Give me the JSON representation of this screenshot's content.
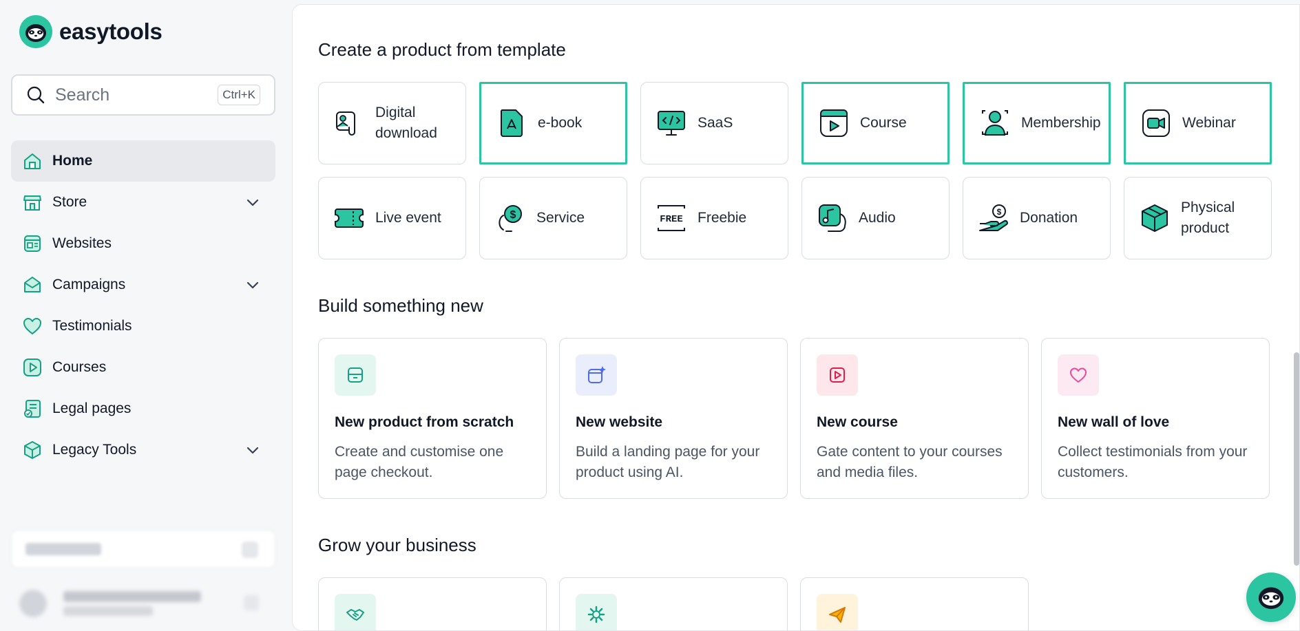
{
  "brand": {
    "name": "easytools",
    "accent": "#2bc5a2"
  },
  "search": {
    "placeholder": "Search",
    "shortcut": "Ctrl+K"
  },
  "sidebar": {
    "items": [
      {
        "label": "Home",
        "icon": "home-icon",
        "active": true
      },
      {
        "label": "Store",
        "icon": "store-icon",
        "expandable": true
      },
      {
        "label": "Websites",
        "icon": "websites-icon"
      },
      {
        "label": "Campaigns",
        "icon": "campaigns-icon",
        "expandable": true
      },
      {
        "label": "Testimonials",
        "icon": "heart-icon"
      },
      {
        "label": "Courses",
        "icon": "play-icon"
      },
      {
        "label": "Legal pages",
        "icon": "legal-icon"
      },
      {
        "label": "Legacy Tools",
        "icon": "box-icon",
        "expandable": true
      }
    ]
  },
  "templates": {
    "title": "Create a product from template",
    "items": [
      {
        "label": "Digital download",
        "icon": "digital-download-icon",
        "highlighted": false
      },
      {
        "label": "e-book",
        "icon": "ebook-icon",
        "highlighted": true
      },
      {
        "label": "SaaS",
        "icon": "saas-icon",
        "highlighted": false
      },
      {
        "label": "Course",
        "icon": "course-icon",
        "highlighted": true
      },
      {
        "label": "Membership",
        "icon": "membership-icon",
        "highlighted": true
      },
      {
        "label": "Webinar",
        "icon": "webinar-icon",
        "highlighted": true
      },
      {
        "label": "Live event",
        "icon": "ticket-icon",
        "highlighted": false
      },
      {
        "label": "Service",
        "icon": "service-icon",
        "highlighted": false
      },
      {
        "label": "Freebie",
        "icon": "free-icon",
        "highlighted": false
      },
      {
        "label": "Audio",
        "icon": "audio-icon",
        "highlighted": false
      },
      {
        "label": "Donation",
        "icon": "donation-icon",
        "highlighted": false
      },
      {
        "label": "Physical product",
        "icon": "physical-product-icon",
        "highlighted": false
      }
    ]
  },
  "build": {
    "title": "Build something new",
    "cards": [
      {
        "title": "New product from scratch",
        "desc": "Create and customise one page checkout.",
        "icon": "package-icon",
        "bg": "#e4f6f0"
      },
      {
        "title": "New website",
        "desc": "Build a landing page for your product using AI.",
        "icon": "ai-website-icon",
        "bg": "#eaeefc"
      },
      {
        "title": "New course",
        "desc": "Gate content to your courses and media files.",
        "icon": "play-icon",
        "bg": "#fde7ea"
      },
      {
        "title": "New wall of love",
        "desc": "Collect testimonials from your customers.",
        "icon": "heart-icon",
        "bg": "#fde9f2"
      }
    ]
  },
  "grow": {
    "title": "Grow your business",
    "cards": [
      {
        "icon": "handshake-icon",
        "bg": "#e4f6f0"
      },
      {
        "icon": "gear-icon",
        "bg": "#e4f6f0"
      },
      {
        "icon": "paper-plane-icon",
        "bg": "#fff3dc"
      }
    ]
  }
}
